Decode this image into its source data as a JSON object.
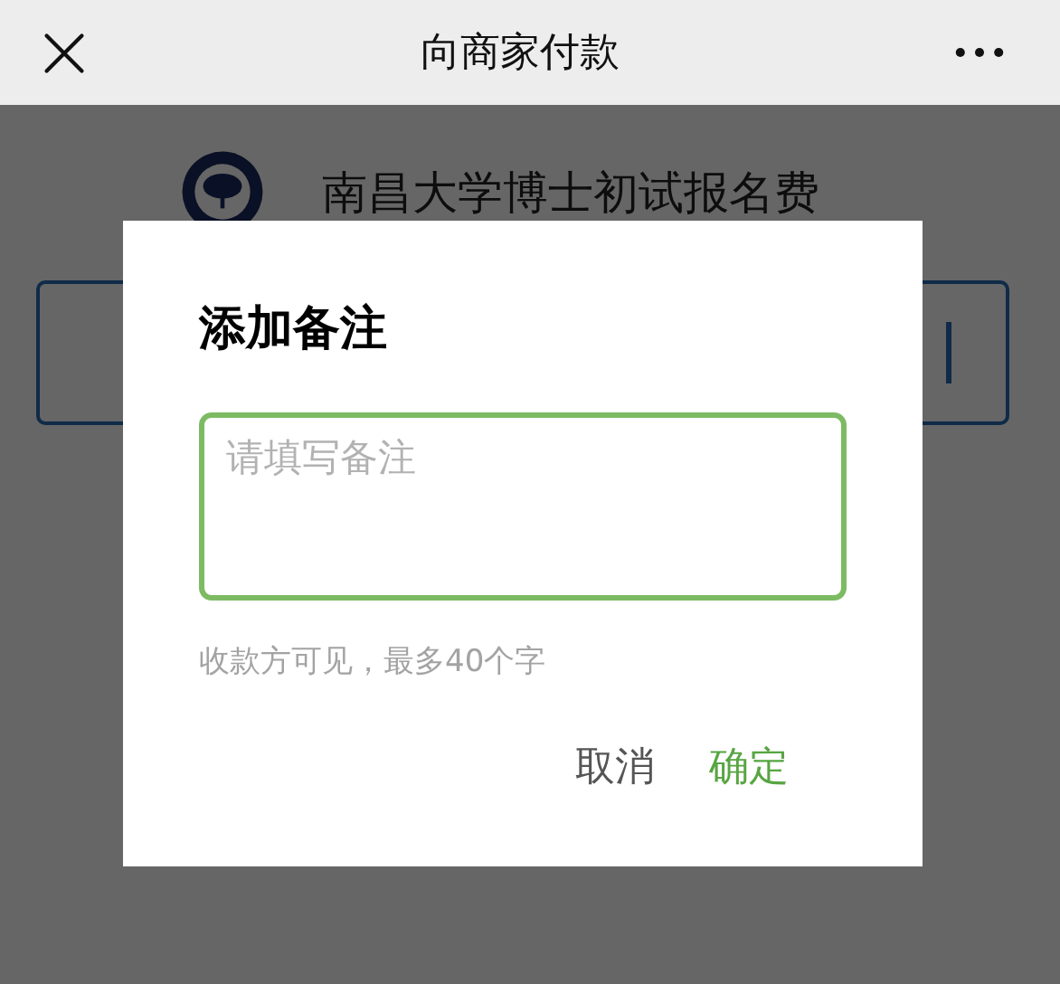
{
  "header": {
    "title": "向商家付款"
  },
  "merchant": {
    "name": "南昌大学博士初试报名费"
  },
  "dialog": {
    "title": "添加备注",
    "note_field": {
      "placeholder": "请填写备注"
    },
    "hint": "收款方可见，最多40个字",
    "buttons": [
      {
        "label": "取消",
        "kind": "cancel"
      },
      {
        "label": "确定",
        "kind": "confirm"
      }
    ]
  }
}
